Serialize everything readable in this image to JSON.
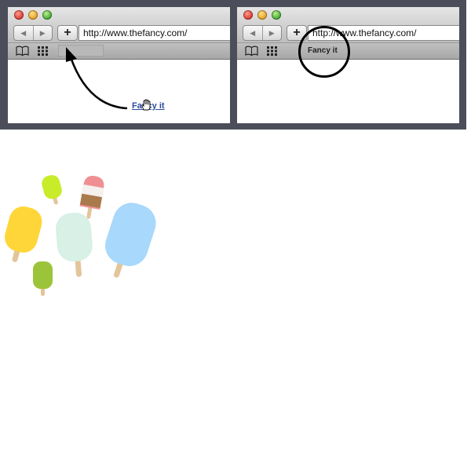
{
  "browser_before": {
    "url": "http://www.thefancy.com/",
    "new_bookmark_button": "+",
    "back_button": "◀",
    "forward_button": "▶",
    "page_link": "Fancy it"
  },
  "browser_after": {
    "url": "http://www.thefancy.com/",
    "new_bookmark_button": "+",
    "back_button": "◀",
    "forward_button": "▶",
    "bookmark_label": "Fancy it"
  },
  "colors": {
    "frame_background": "#4b4e5a",
    "link": "#2b4a9e",
    "popsicle_yellow": "#ffd63a",
    "popsicle_lime": "#c8ec2a",
    "popsicle_mint": "#d8f0e6",
    "popsicle_blue": "#a8d8fb",
    "popsicle_green": "#9cc43a",
    "popsicle_pink": "#f08f92",
    "stick": "#e3c59a"
  },
  "icons": [
    "book-icon",
    "grid-icon",
    "hand-cursor-icon",
    "curved-arrow-icon"
  ]
}
